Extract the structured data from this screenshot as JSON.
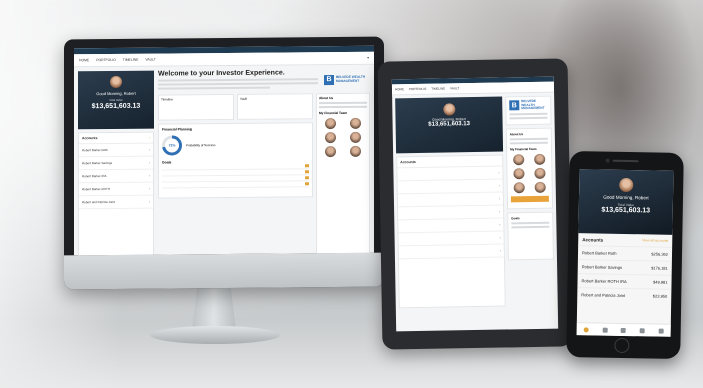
{
  "monitor": {
    "nav": [
      "HOME",
      "PORTFOLIO",
      "TIMELINE",
      "VAULT"
    ],
    "greeting": "Good Morning, Robert",
    "total_label": "Total Value",
    "total_value": "$13,651,603.13",
    "accounts_title": "Accounts",
    "accounts": [
      "Robert Barker Roth",
      "Robert Barker Savings",
      "Robert Barker IRA",
      "Robert Barker ROTH",
      "Robert and Patricia Joint"
    ],
    "welcome": "Welcome to your Investor Experience.",
    "brand": "BELVEDE WEALTH MANAGEMENT",
    "brand_short": "B",
    "cards": [
      "Timeline",
      "Vault"
    ],
    "financial_planning": "Financial Planning",
    "probability_label": "Probability of Success",
    "probability": "72%",
    "goals_title": "Goals",
    "team_title": "My Financial Team",
    "about_title": "About Us"
  },
  "tablet": {
    "nav": [
      "HOME",
      "PORTFOLIO",
      "TIMELINE",
      "VAULT"
    ],
    "greeting": "Good Morning, Robert",
    "total_value": "$13,651,603.13",
    "brand": "BELVEDE WEALTH MANAGEMENT",
    "brand_short": "B",
    "accounts_title": "Accounts",
    "about_title": "About Us",
    "team_title": "My Financial Team",
    "goals_title": "Goals"
  },
  "phone": {
    "greeting": "Good Morning, Robert",
    "total_label": "Total Value",
    "total_value": "$13,651,603.13",
    "accounts_title": "Accounts",
    "view_all": "View all accounts",
    "accounts": [
      {
        "name": "Robert Barker Roth",
        "value": "$256,362"
      },
      {
        "name": "Robert Barker Savings",
        "value": "$176,181"
      },
      {
        "name": "Robert Barker ROTH IRA",
        "value": "$49,981"
      },
      {
        "name": "Robert and Patricia Joint",
        "value": "$23,950"
      }
    ]
  }
}
